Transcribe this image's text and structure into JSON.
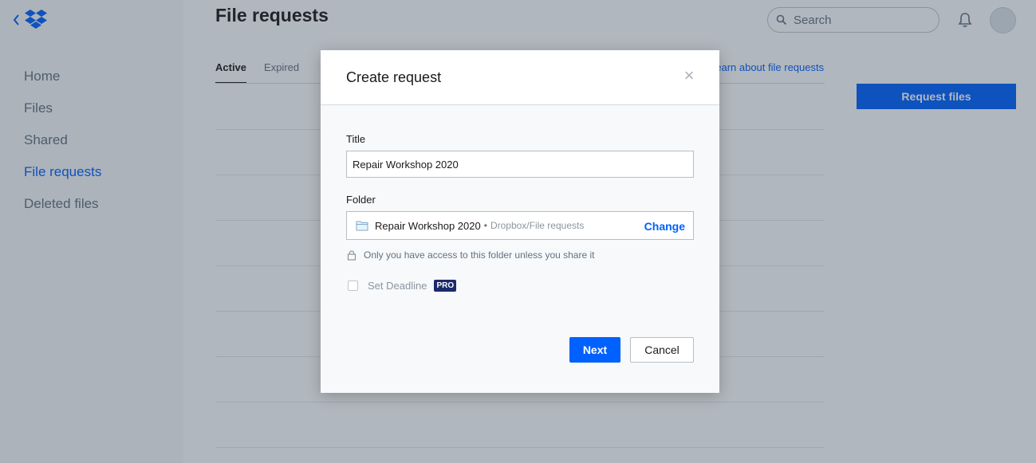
{
  "sidebar": {
    "items": [
      {
        "label": "Home"
      },
      {
        "label": "Files"
      },
      {
        "label": "Shared"
      },
      {
        "label": "File requests"
      },
      {
        "label": "Deleted files"
      }
    ]
  },
  "header": {
    "title": "File requests",
    "search_placeholder": "Search"
  },
  "tabs": [
    {
      "label": "Active"
    },
    {
      "label": "Expired"
    }
  ],
  "learn_link": "Learn about file requests",
  "request_files_label": "Request files",
  "modal": {
    "title": "Create request",
    "close_glyph": "×",
    "title_label": "Title",
    "title_value": "Repair Workshop 2020",
    "folder_label": "Folder",
    "folder_name": "Repair Workshop 2020",
    "folder_separator": "•",
    "folder_path": "Dropbox/File requests",
    "change_label": "Change",
    "access_note": "Only you have access to this folder unless you share it",
    "deadline_label": "Set Deadline",
    "deadline_checked": false,
    "pro_badge": "PRO",
    "next_label": "Next",
    "cancel_label": "Cancel"
  },
  "colors": {
    "accent": "#0061fe",
    "pro_badge": "#1a2b6b"
  },
  "icons": [
    "back-chevron-icon",
    "dropbox-logo-icon",
    "search-icon",
    "bell-icon",
    "avatar",
    "close-icon",
    "folder-icon",
    "lock-icon"
  ]
}
